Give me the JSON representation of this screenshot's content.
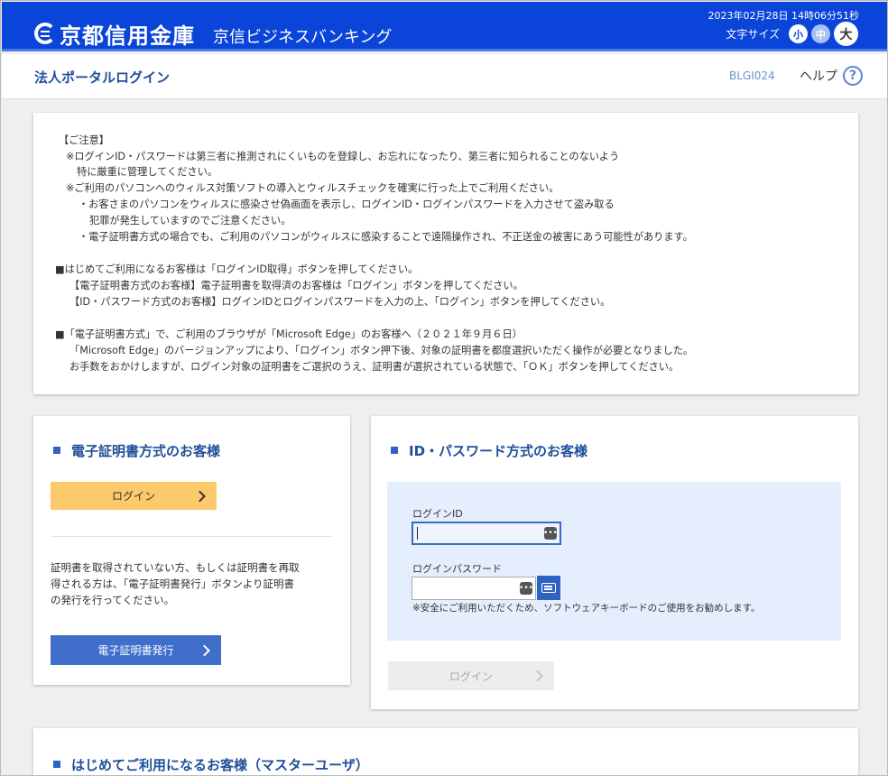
{
  "header": {
    "brand_name": "京都信用金庫",
    "brand_sub": "京信ビジネスバンキング",
    "datetime": "2023年02月28日 14時06分51秒",
    "font_size_label": "文字サイズ",
    "font_sizes": [
      "小",
      "中",
      "大"
    ],
    "colors": {
      "bar": "#0a44d8",
      "accent": "#4a79e6"
    }
  },
  "titlebar": {
    "page_title": "法人ポータルログイン",
    "screen_id": "BLGI024",
    "help_label": "ヘルプ",
    "help_icon": "?"
  },
  "notice": {
    "lines": [
      "【ご注意】",
      "※ログインID・パスワードは第三者に推測されにくいものを登録し、お忘れになったり、第三者に知られることのないよう",
      "特に厳重に管理してください。",
      "※ご利用のパソコンへのウィルス対策ソフトの導入とウィルスチェックを確実に行った上でご利用ください。",
      "・お客さまのパソコンをウィルスに感染させ偽画面を表示し、ログインID・ログインパスワードを入力させて盗み取る",
      "犯罪が発生していますのでご注意ください。",
      "・電子証明書方式の場合でも、ご利用のパソコンがウィルスに感染することで遠隔操作され、不正送金の被害にあう可能性があります。",
      "■はじめてご利用になるお客様は「ログインID取得」ボタンを押してください。",
      "【電子証明書方式のお客様】電子証明書を取得済のお客様は「ログイン」ボタンを押してください。",
      "【ID・パスワード方式のお客様】ログインIDとログインパスワードを入力の上、「ログイン」ボタンを押してください。",
      "■「電子証明書方式」で、ご利用のブラウザが「Microsoft Edge」のお客様へ（２０２１年９月６日）",
      "「Microsoft Edge」のバージョンアップにより、「ログイン」ボタン押下後、対象の証明書を都度選択いただく操作が必要となりました。",
      "お手数をおかけしますが、ログイン対象の証明書をご選択のうえ、証明書が選択されている状態で、「ＯＫ」ボタンを押してください。"
    ]
  },
  "cert_card": {
    "title": "電子証明書方式のお客様",
    "login_label": "ログイン",
    "description": [
      "証明書を取得されていない方、もしくは証明書を再取",
      "得される方は、「電子証明書発行」ボタンより証明書",
      "の発行を行ってください。"
    ],
    "issue_label": "電子証明書発行"
  },
  "id_card": {
    "title": "ID・パスワード方式のお客様",
    "login_id_label": "ログインID",
    "login_id_value": "",
    "password_label": "ログインパスワード",
    "password_value": "",
    "hint": "※安全にご利用いただくため、ソフトウェアキーボードのご使用をお勧めします。",
    "login_label": "ログイン",
    "dots_icon": "•••"
  },
  "first_card": {
    "title": "はじめてご利用になるお客様（マスターユーザ）"
  }
}
